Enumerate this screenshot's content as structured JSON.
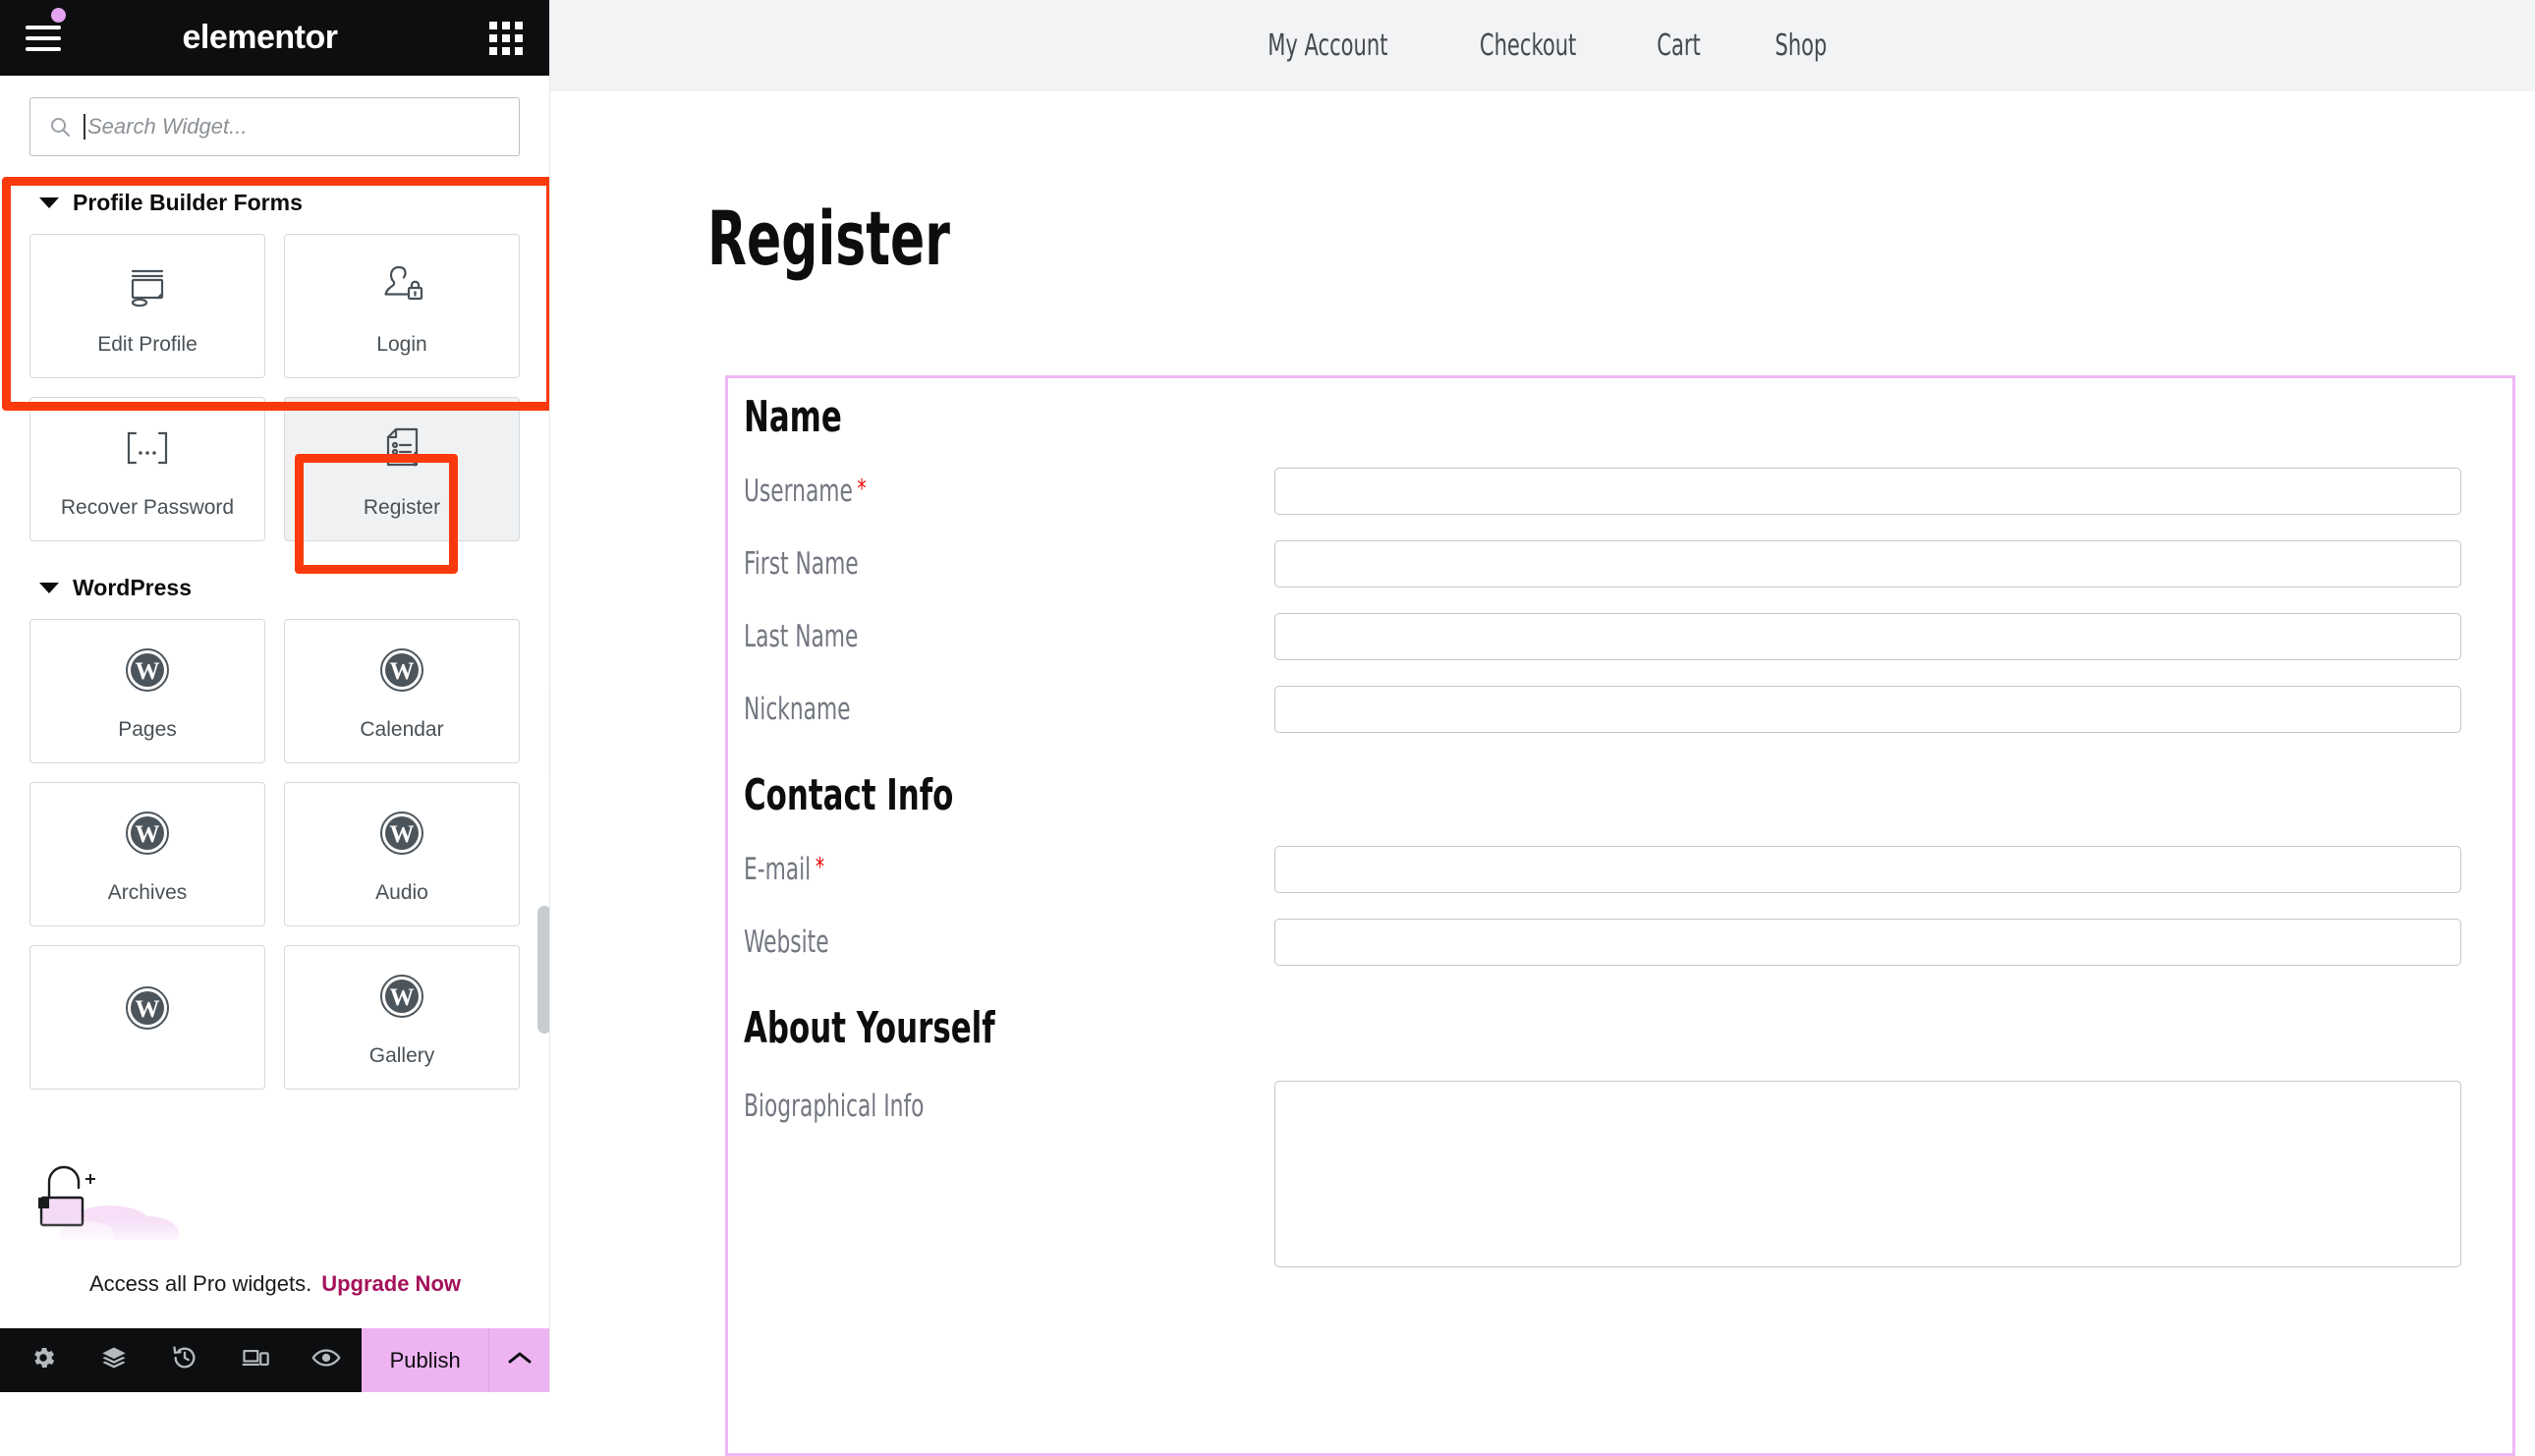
{
  "panel": {
    "header": {
      "brand": "elementor",
      "hamburger_icon": "hamburger-menu-icon",
      "notification_dot": "notification-dot",
      "grid_icon": "widgets-grid-icon"
    },
    "search": {
      "placeholder": "Search Widget...",
      "value": "",
      "icon": "search-icon"
    },
    "categories": [
      {
        "title": "Profile Builder Forms",
        "expanded": true,
        "widgets": [
          {
            "label": "Edit Profile",
            "icon": "monitor-edit-icon",
            "selected": false
          },
          {
            "label": "Login",
            "icon": "user-lock-icon",
            "selected": false
          },
          {
            "label": "Recover Password",
            "icon": "bracket-ellipsis-icon",
            "selected": false
          },
          {
            "label": "Register",
            "icon": "document-list-dollar-icon",
            "selected": true
          }
        ]
      },
      {
        "title": "WordPress",
        "expanded": true,
        "widgets": [
          {
            "label": "Pages",
            "icon": "wordpress-icon",
            "selected": false
          },
          {
            "label": "Calendar",
            "icon": "wordpress-icon",
            "selected": false
          },
          {
            "label": "Archives",
            "icon": "wordpress-icon",
            "selected": false
          },
          {
            "label": "Audio",
            "icon": "wordpress-icon",
            "selected": false
          },
          {
            "label": "",
            "icon": "wordpress-icon",
            "selected": false
          },
          {
            "label": "Gallery",
            "icon": "wordpress-icon",
            "selected": false
          }
        ]
      }
    ],
    "upsell": {
      "text": "Access all Pro widgets.",
      "link_label": "Upgrade Now",
      "link_color": "#a4115b",
      "illustration": "unlock-padlock-clouds"
    },
    "footer": {
      "icons": [
        {
          "name": "settings-gear-icon"
        },
        {
          "name": "navigator-layers-icon"
        },
        {
          "name": "history-revisions-icon"
        },
        {
          "name": "responsive-mode-icon"
        },
        {
          "name": "preview-eye-icon"
        }
      ],
      "publish_label": "Publish",
      "publish_chevron_icon": "chevron-up-icon",
      "publish_color": "#eeb4f2"
    },
    "collapse_handle_icon": "chevron-left-icon",
    "scrollbar": "panel-scrollbar"
  },
  "canvas": {
    "site_nav": [
      {
        "label": "My Account"
      },
      {
        "label": "Checkout"
      },
      {
        "label": "Cart"
      },
      {
        "label": "Shop"
      }
    ],
    "page_title": "Register",
    "selection_border_color": "#f0b6f5",
    "sections": [
      {
        "heading": "Name",
        "fields": [
          {
            "label": "Username",
            "required": true,
            "type": "text",
            "value": ""
          },
          {
            "label": "First Name",
            "required": false,
            "type": "text",
            "value": ""
          },
          {
            "label": "Last Name",
            "required": false,
            "type": "text",
            "value": ""
          },
          {
            "label": "Nickname",
            "required": false,
            "type": "text",
            "value": ""
          }
        ]
      },
      {
        "heading": "Contact Info",
        "fields": [
          {
            "label": "E-mail",
            "required": true,
            "type": "text",
            "value": ""
          },
          {
            "label": "Website",
            "required": false,
            "type": "text",
            "value": ""
          }
        ]
      },
      {
        "heading": "About Yourself",
        "fields": [
          {
            "label": "Biographical Info",
            "required": false,
            "type": "textarea",
            "value": ""
          }
        ]
      }
    ]
  },
  "annotations": {
    "color": "#fa3a0c",
    "boxes": [
      {
        "name": "profile-builder-forms-section"
      },
      {
        "name": "register-widget"
      }
    ]
  }
}
